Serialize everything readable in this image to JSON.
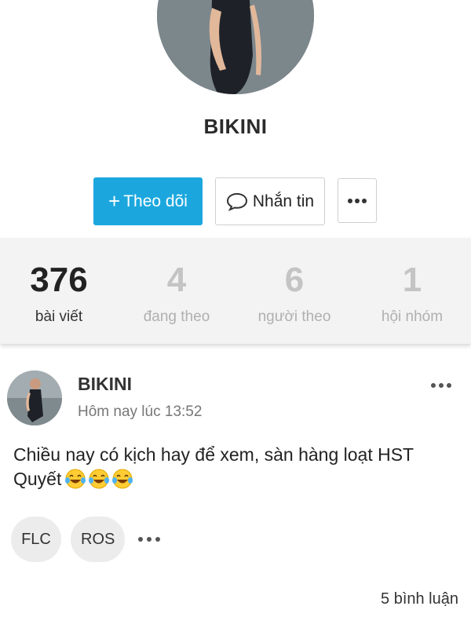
{
  "profile": {
    "name": "BIKINI"
  },
  "actions": {
    "follow_label": "Theo dõi",
    "follow_icon": "plus-icon",
    "message_label": "Nhắn tin",
    "message_icon": "chat-bubble-icon",
    "more_icon": "more-dots-icon"
  },
  "stats": [
    {
      "value": "376",
      "label": "bài viết"
    },
    {
      "value": "4",
      "label": "đang theo"
    },
    {
      "value": "6",
      "label": "người theo"
    },
    {
      "value": "1",
      "label": "hội nhóm"
    }
  ],
  "post": {
    "author": "BIKINI",
    "time": "Hôm nay lúc 13:52",
    "text": "Chiều nay có kịch hay để xem, sàn hàng loạt HST Quyết",
    "emoji": "laughing-tears-emoji",
    "tags": [
      "FLC",
      "ROS"
    ],
    "comments": "5 bình luận"
  },
  "colors": {
    "accent": "#1ba7de",
    "stats_bg": "#f3f3f3",
    "muted": "#c4c4c4"
  }
}
